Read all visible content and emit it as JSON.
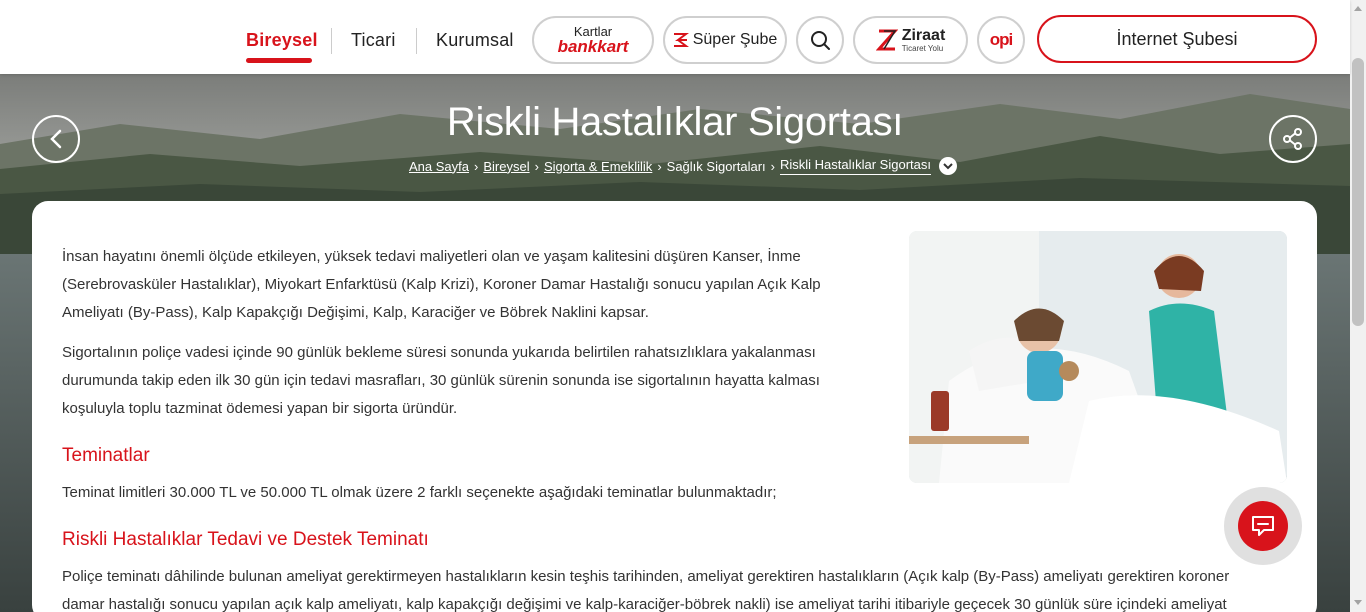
{
  "header": {
    "nav": [
      {
        "label": "Bireysel",
        "active": true
      },
      {
        "label": "Ticari",
        "active": false
      },
      {
        "label": "Kurumsal",
        "active": false
      }
    ],
    "kartlar": {
      "top": "Kartlar",
      "bottom": "bankkart"
    },
    "super_sube": "Süper Şube",
    "ziraat": {
      "main": "Ziraat",
      "sub": "Ticaret Yolu"
    },
    "opi": "opi",
    "internet_subesi": "İnternet Şubesi"
  },
  "hero": {
    "title": "Riskli Hastalıklar Sigortası",
    "breadcrumb": [
      {
        "label": "Ana Sayfa",
        "link": true
      },
      {
        "label": "Bireysel",
        "link": true
      },
      {
        "label": "Sigorta & Emeklilik",
        "link": true
      },
      {
        "label": "Sağlık Sigortaları",
        "link": false
      },
      {
        "label": "Riskli Hastalıklar Sigortası",
        "link": false
      }
    ]
  },
  "content": {
    "intro_1": "İnsan hayatını önemli ölçüde etkileyen, yüksek tedavi maliyetleri olan ve yaşam kalitesini düşüren Kanser, İnme (Serebrovasküler Hastalıklar), Miyokart Enfarktüsü (Kalp Krizi), Koroner Damar Hastalığı sonucu yapılan Açık Kalp Ameliyatı (By-Pass), Kalp Kapakçığı Değişimi, Kalp, Karaciğer ve Böbrek Naklini kapsar.",
    "intro_2": "Sigortalının poliçe vadesi içinde 90 günlük bekleme süresi sonunda yukarıda belirtilen rahatsızlıklara yakalanması durumunda takip eden ilk 30 gün için tedavi masrafları, 30 günlük sürenin sonunda ise sigortalının hayatta kalması koşuluyla toplu tazminat ödemesi yapan bir sigorta üründür.",
    "h_teminatlar": "Teminatlar",
    "teminat_text": "Teminat limitleri 30.000 TL ve 50.000 TL olmak üzere 2 farklı seçenekte aşağıdaki teminatlar bulunmaktadır;",
    "h_tedavi": "Riskli Hastalıklar Tedavi ve Destek Teminatı",
    "tedavi_text": "Poliçe teminatı dâhilinde bulunan ameliyat gerektirmeyen hastalıkların kesin teşhis tarihinden, ameliyat gerektiren hastalıkların (Açık kalp (By-Pass) ameliyatı gerektiren koroner damar hastalığı sonucu yapılan açık kalp ameliyatı, kalp kapakçığı değişimi ve kalp-karaciğer-böbrek nakli) ise ameliyat tarihi itibariyle geçecek 30 günlük süre içindeki ameliyat"
  },
  "colors": {
    "brand_red": "#d8131b",
    "text": "#333333"
  }
}
